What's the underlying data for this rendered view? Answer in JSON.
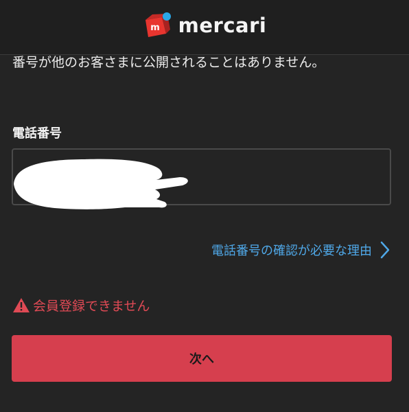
{
  "header": {
    "logo_text": "mercari",
    "logo_mark_letter": "m"
  },
  "notice": {
    "text": "番号が他のお客さまに公開されることはありません。"
  },
  "phone_field": {
    "label": "電話番号",
    "value": "",
    "redacted": true
  },
  "reason_link": {
    "label": "電話番号の確認が必要な理由",
    "icon": "chevron-right-icon"
  },
  "error": {
    "icon": "warning-icon",
    "message": "会員登録できません"
  },
  "next_button": {
    "label": "次へ"
  },
  "colors": {
    "background": "#242424",
    "accent_red": "#d63f4e",
    "error_red": "#e04a55",
    "link_blue": "#4fa8e8",
    "logo_red": "#e8352f",
    "logo_blue": "#2aa6e6"
  }
}
